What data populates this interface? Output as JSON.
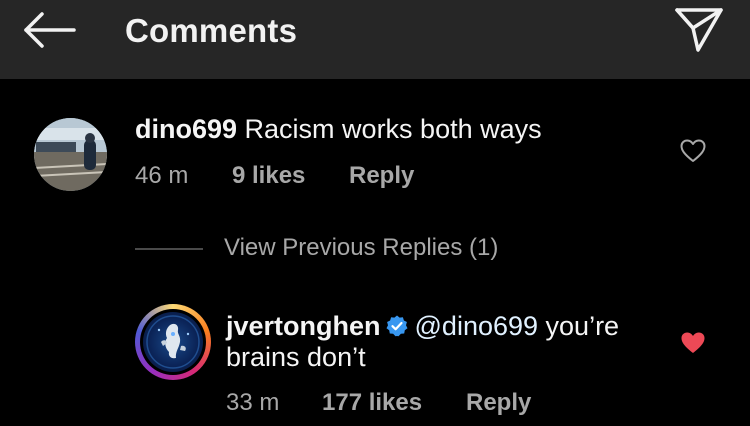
{
  "header": {
    "title": "Comments"
  },
  "comments": [
    {
      "username": "dino699",
      "text": "Racism works both ways",
      "time": "46 m",
      "likes": "9 likes",
      "reply_label": "Reply"
    },
    {
      "username": "jvertonghen",
      "mention": "@dino699",
      "text_line1_rest": " you’re",
      "text_line2": "brains don’t",
      "time": "33 m",
      "likes": "177 likes",
      "reply_label": "Reply",
      "liked": true
    }
  ],
  "view_previous_replies": "View Previous Replies (1)",
  "colors": {
    "header_bg": "#262626",
    "page_bg": "#000000",
    "secondary_text": "#a8a8a8",
    "liked_heart": "#ed4956",
    "verified_badge": "#3897f0"
  },
  "icons": {
    "back": "arrow-left-icon",
    "send": "paper-plane-icon",
    "like": "heart-outline-icon",
    "liked": "heart-filled-icon",
    "verified": "verified-badge-icon"
  }
}
